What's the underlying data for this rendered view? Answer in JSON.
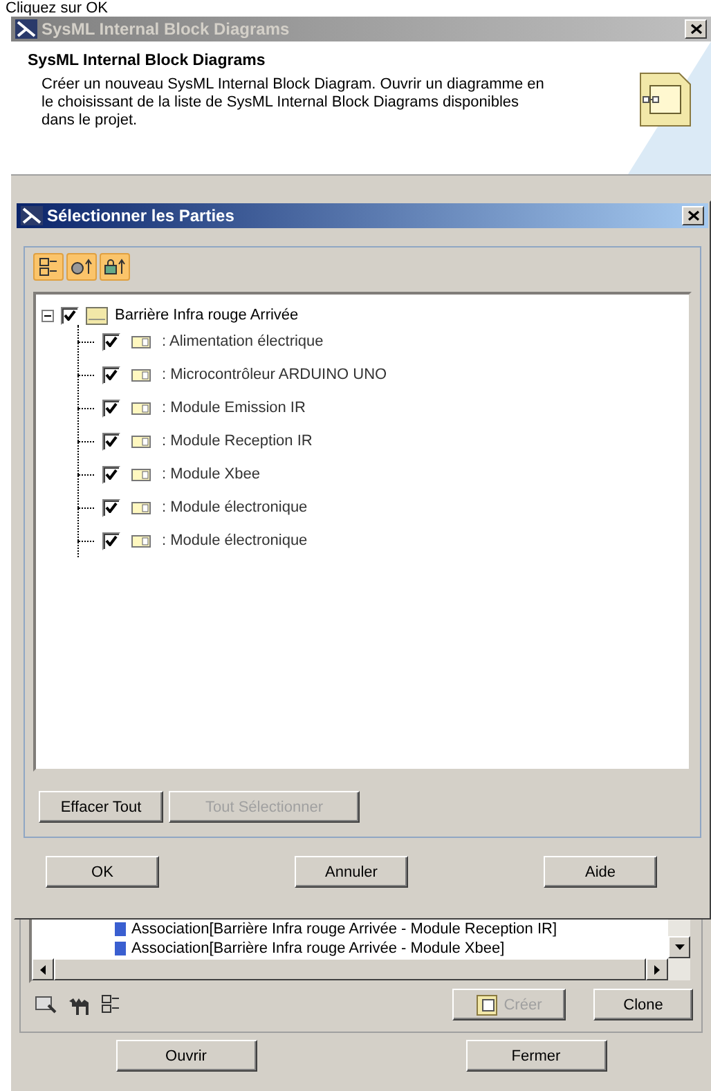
{
  "caption": "Cliquez sur OK",
  "back_window": {
    "title": "SysML Internal Block Diagrams",
    "header_title": "SysML Internal Block Diagrams",
    "description": "Créer un nouveau SysML Internal Block Diagram. Ouvrir un diagramme en le choisissant de la liste de SysML Internal Block Diagrams disponibles dans le projet.",
    "list_rows": [
      {
        "text": "Association[Barrière Infra rouge Arrivée - Module Reception IR]"
      },
      {
        "text": "Association[Barrière Infra rouge Arrivée - Module Xbee]"
      }
    ],
    "buttons": [
      {
        "label": "Créer",
        "disabled": true,
        "kind": "icon"
      },
      {
        "label": "Clone",
        "disabled": false,
        "kind": "plain"
      }
    ],
    "footer_buttons": [
      "Ouvrir",
      "Fermer"
    ]
  },
  "dialog": {
    "title": "Sélectionner les Parties",
    "tree": {
      "label": "Barrière Infra rouge Arrivée",
      "checked": true,
      "expanded": true,
      "children": [
        {
          "label": ": Alimentation électrique",
          "checked": true
        },
        {
          "label": ": Microcontrôleur ARDUINO UNO",
          "checked": true
        },
        {
          "label": ": Module Emission IR",
          "checked": true
        },
        {
          "label": ": Module Reception IR",
          "checked": true
        },
        {
          "label": ": Module Xbee",
          "checked": true
        },
        {
          "label": ": Module électronique",
          "checked": true
        },
        {
          "label": ": Module électronique",
          "checked": true
        }
      ]
    },
    "panel_buttons": [
      {
        "label": "Effacer Tout",
        "disabled": false
      },
      {
        "label": "Tout Sélectionner",
        "disabled": true
      }
    ],
    "buttons": [
      "OK",
      "Annuler",
      "Aide"
    ]
  }
}
